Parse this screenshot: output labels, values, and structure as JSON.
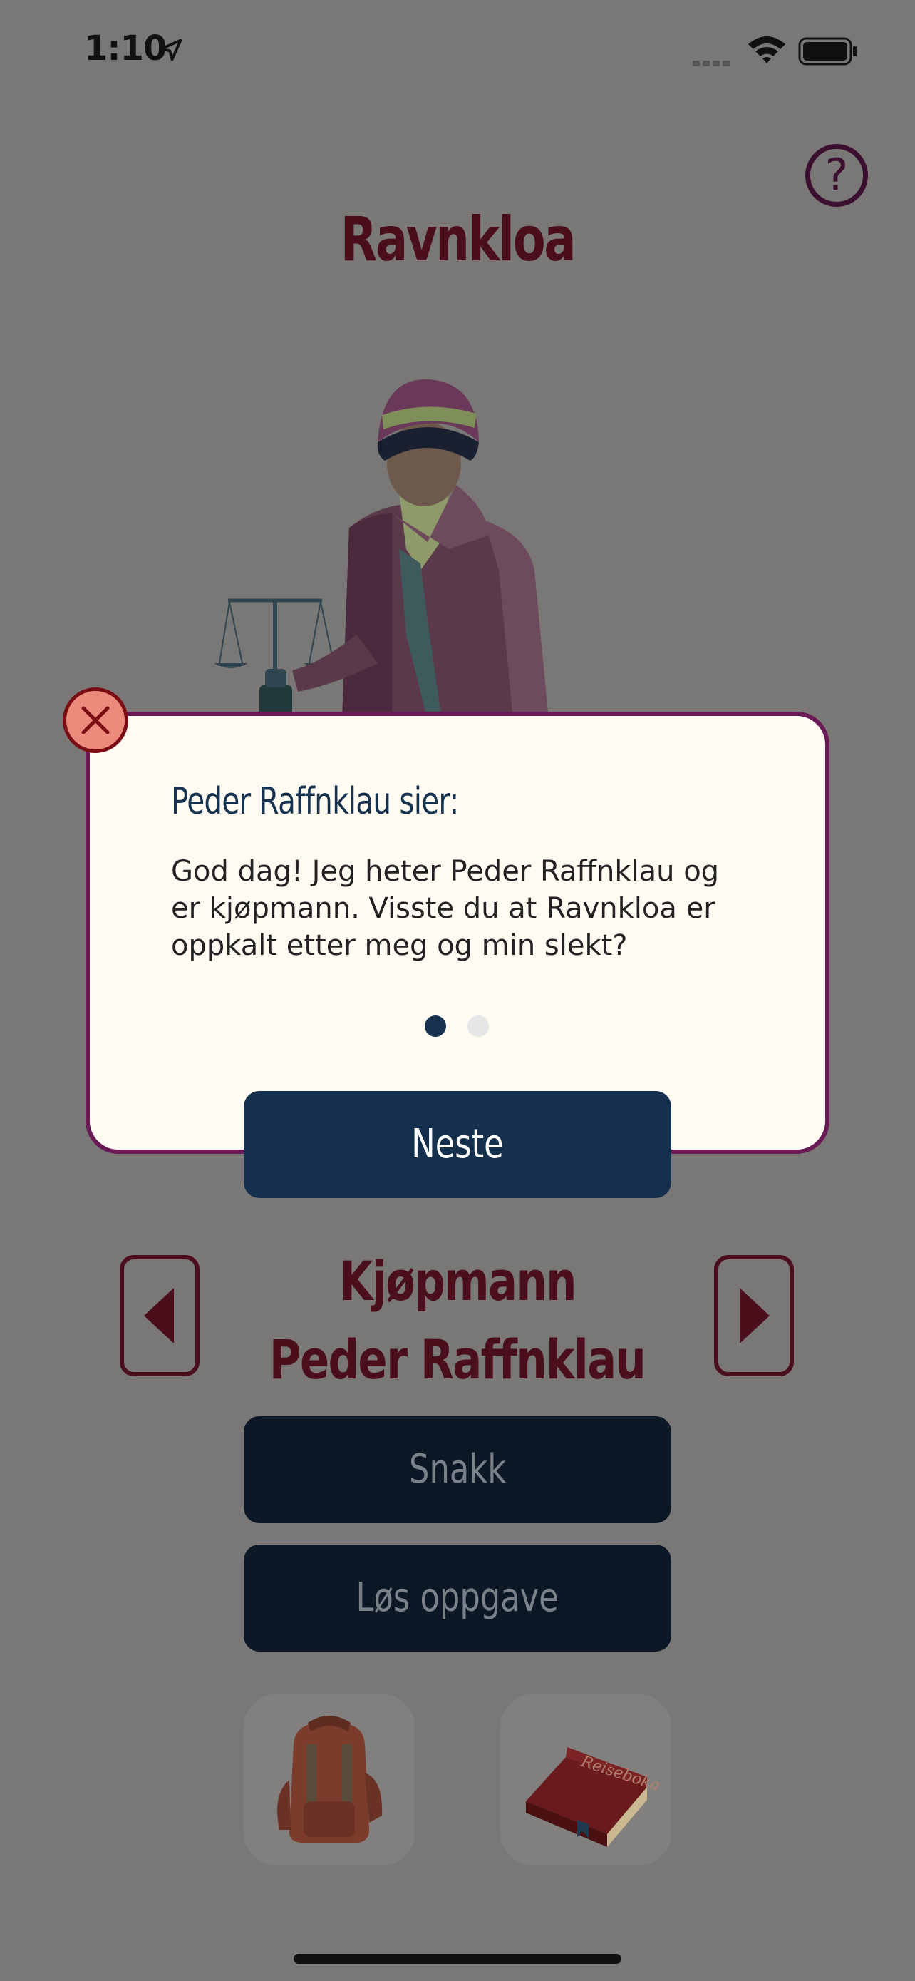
{
  "status_bar": {
    "time": "1:10"
  },
  "header": {
    "title": "Ravnkloa",
    "help_label": "?"
  },
  "dialog": {
    "speaker": "Peder Raffnklau sier:",
    "message": "God dag! Jeg heter Peder Raffnklau og er kjøpmann. Visste du at Ravnkloa er oppkalt etter meg og min slekt?",
    "page_dots": [
      {
        "active": true
      },
      {
        "active": false
      }
    ],
    "next_label": "Neste"
  },
  "character": {
    "role": "Kjøpmann",
    "name": "Peder Raffnklau"
  },
  "actions": {
    "talk_label": "Snakk",
    "solve_label": "Løs oppgave"
  },
  "travel_book": {
    "cover_text": "Reiseboka"
  },
  "colors": {
    "overlay": "#7a7876",
    "title": "#4a0f1a",
    "dialog_border": "#6a1a55",
    "primary_button": "#14304d",
    "close_button": "#ec8a7c"
  }
}
